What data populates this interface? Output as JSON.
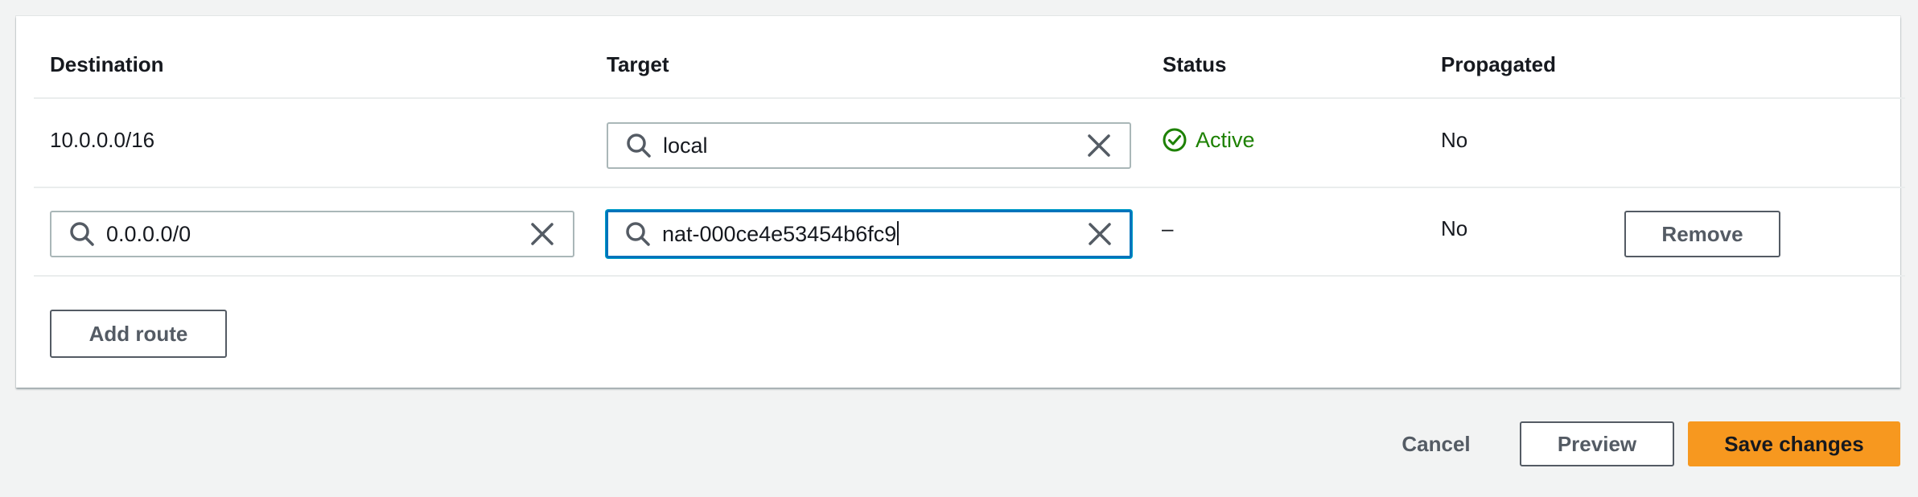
{
  "table": {
    "headers": {
      "destination": "Destination",
      "target": "Target",
      "status": "Status",
      "propagated": "Propagated"
    },
    "rows": [
      {
        "destination": "10.0.0.0/16",
        "target": "local",
        "status": "Active",
        "propagated": "No"
      },
      {
        "destination": "0.0.0.0/0",
        "target": "nat-000ce4e53454b6fc9",
        "status": "–",
        "propagated": "No",
        "remove_label": "Remove"
      }
    ],
    "add_route_label": "Add route"
  },
  "footer": {
    "cancel_label": "Cancel",
    "preview_label": "Preview",
    "save_label": "Save changes"
  },
  "icons": {
    "search": "search-icon",
    "clear": "close-icon",
    "status_ok": "check-circle-icon"
  },
  "colors": {
    "primary_button": "#f7981f",
    "focus_border": "#0073bb",
    "success": "#1d8102"
  }
}
